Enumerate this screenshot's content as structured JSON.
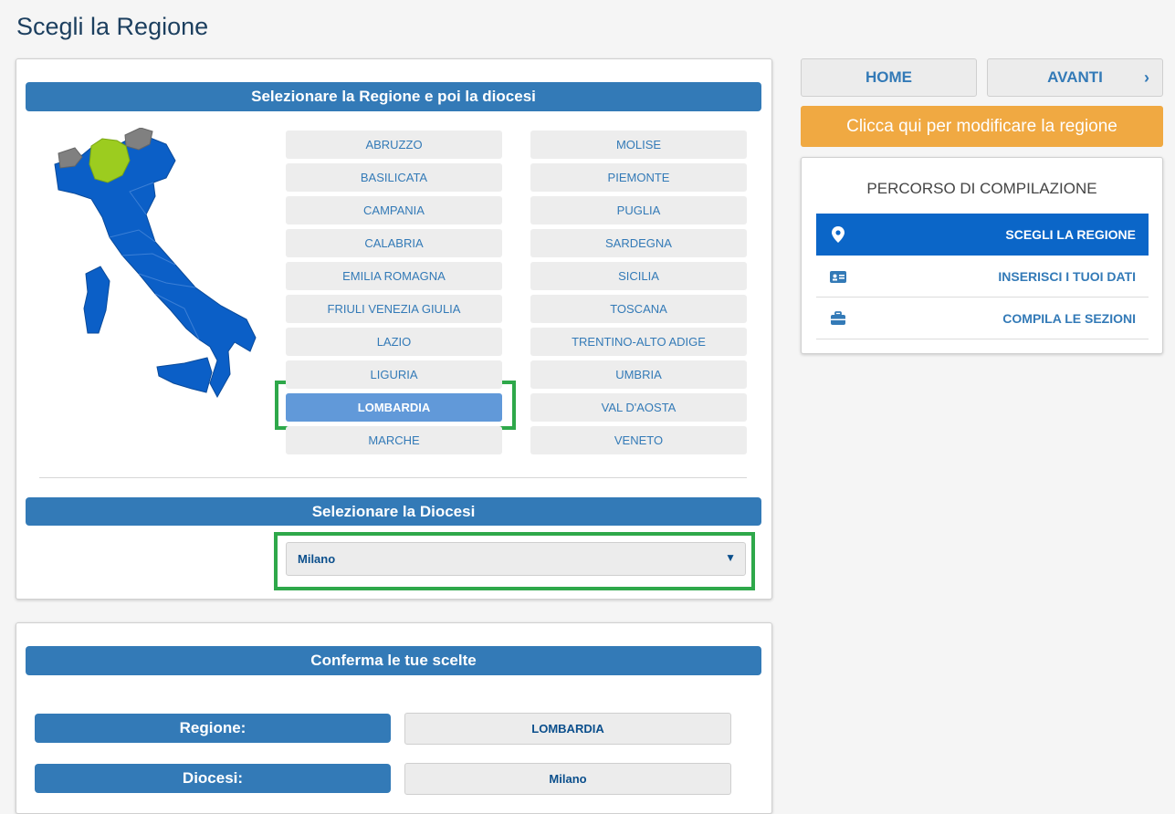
{
  "page_title": "Scegli la Regione",
  "region_section": {
    "header": "Selezionare la Regione e poi la diocesi",
    "regions_col1": [
      "ABRUZZO",
      "BASILICATA",
      "CAMPANIA",
      "CALABRIA",
      "EMILIA ROMAGNA",
      "FRIULI VENEZIA GIULIA",
      "LAZIO",
      "LIGURIA",
      "LOMBARDIA",
      "MARCHE"
    ],
    "regions_col2": [
      "MOLISE",
      "PIEMONTE",
      "PUGLIA",
      "SARDEGNA",
      "SICILIA",
      "TOSCANA",
      "TRENTINO-ALTO ADIGE",
      "UMBRIA",
      "VAL D'AOSTA",
      "VENETO"
    ],
    "selected_region": "LOMBARDIA"
  },
  "diocese_section": {
    "header": "Selezionare la Diocesi",
    "selected": "Milano"
  },
  "confirm_section": {
    "header": "Conferma le tue scelte",
    "region_label": "Regione:",
    "region_value": "LOMBARDIA",
    "diocese_label": "Diocesi:",
    "diocese_value": "Milano"
  },
  "nav": {
    "home": "HOME",
    "next": "AVANTI",
    "next_icon": "chevron-right-icon",
    "modify_region": "Clicca qui per modificare la regione"
  },
  "route": {
    "title": "PERCORSO DI COMPILAZIONE",
    "steps": [
      {
        "label": "SCEGLI LA REGIONE",
        "icon": "map-marker-icon",
        "active": true
      },
      {
        "label": "INSERISCI I TUOI DATI",
        "icon": "id-card-icon",
        "active": false
      },
      {
        "label": "COMPILA LE SEZIONI",
        "icon": "briefcase-icon",
        "active": false
      }
    ]
  },
  "colors": {
    "primary": "#337ab7",
    "active_step": "#0b66c8",
    "orange": "#f0a942",
    "highlight": "#2ea84a",
    "map_region": "#0b5fc7",
    "map_selected": "#9ccc1f",
    "map_neutral": "#808080"
  }
}
